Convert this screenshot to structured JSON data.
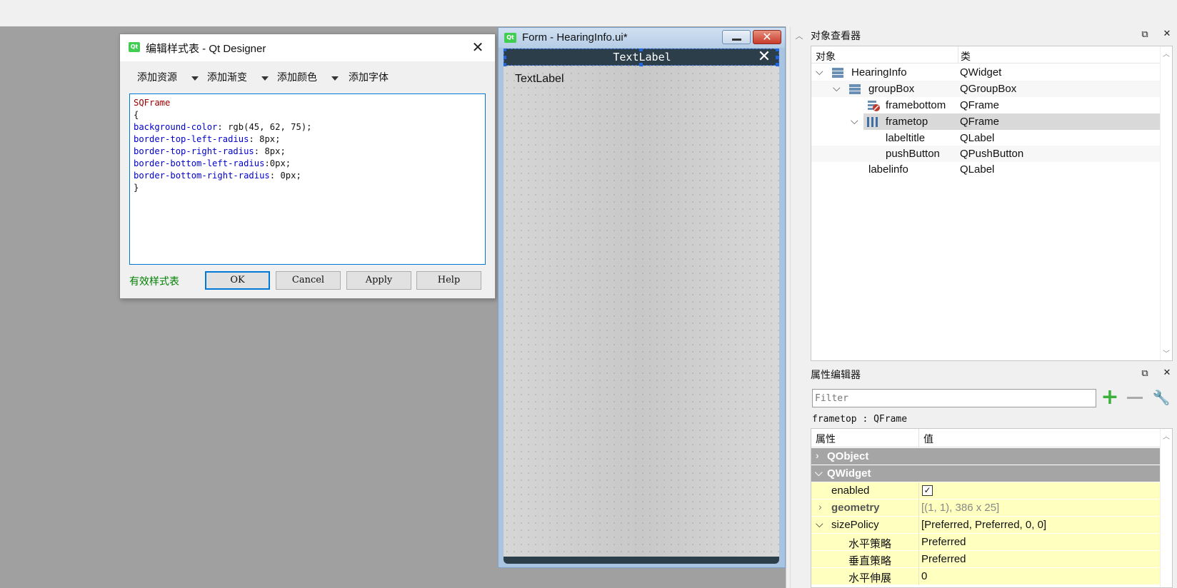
{
  "dialog": {
    "title": "编辑样式表 - Qt Designer",
    "close_glyph": "✕",
    "icon_text": "Qt",
    "toolbar": [
      "添加资源",
      "添加渐变",
      "添加颜色",
      "添加字体"
    ],
    "code": {
      "selector": "SQFrame",
      "open": "{",
      "props": [
        {
          "name": "background-color",
          "sep": ": ",
          "value": "rgb(45, 62, 75);"
        },
        {
          "name": "border-top-left-radius",
          "sep": ": ",
          "value": "8px;"
        },
        {
          "name": "border-top-right-radius",
          "sep": ": ",
          "value": "8px;"
        },
        {
          "name": "border-bottom-left-radius",
          "sep": ":",
          "value": "0px;"
        },
        {
          "name": "border-bottom-right-radius",
          "sep": ": ",
          "value": "0px;"
        }
      ],
      "close": "}"
    },
    "status": "有效样式表",
    "buttons": {
      "ok": "OK",
      "cancel": "Cancel",
      "apply": "Apply",
      "help": "Help"
    }
  },
  "form": {
    "title": "Form - HearingInfo.ui*",
    "icon_text": "Qt",
    "close_glyph": "✕",
    "frametop_label": "TextLabel",
    "frametop_close": "✕",
    "labelinfo_text": "TextLabel"
  },
  "object_inspector": {
    "title": "对象查看器",
    "columns": {
      "object": "对象",
      "class": "类"
    },
    "rows": [
      {
        "name": "HearingInfo",
        "class": "QWidget",
        "expanded": true,
        "icon": "widget-icon"
      },
      {
        "name": "groupBox",
        "class": "QGroupBox",
        "expanded": true,
        "icon": "groupbox-icon"
      },
      {
        "name": "framebottom",
        "class": "QFrame",
        "icon": "frame-error-icon"
      },
      {
        "name": "frametop",
        "class": "QFrame",
        "expanded": true,
        "selected": true,
        "icon": "frame-layout-icon"
      },
      {
        "name": "labeltitle",
        "class": "QLabel"
      },
      {
        "name": "pushButton",
        "class": "QPushButton"
      },
      {
        "name": "labelinfo",
        "class": "QLabel"
      }
    ]
  },
  "property_editor": {
    "title": "属性编辑器",
    "filter_placeholder": "Filter",
    "object_line": "frametop : QFrame",
    "columns": {
      "property": "属性",
      "value": "值"
    },
    "rows": [
      {
        "type": "group",
        "name": "QObject",
        "collapsed": true
      },
      {
        "type": "group",
        "name": "QWidget",
        "collapsed": false
      },
      {
        "type": "prop",
        "name": "enabled",
        "value": "✓"
      },
      {
        "type": "prop",
        "name": "geometry",
        "value": "[(1, 1), 386 x 25]",
        "expandable": true,
        "bold": true,
        "dim": true
      },
      {
        "type": "prop",
        "name": "sizePolicy",
        "value": "[Preferred, Preferred, 0, 0]",
        "expanded": true
      },
      {
        "type": "sub",
        "name": "水平策略",
        "value": "Preferred"
      },
      {
        "type": "sub",
        "name": "垂直策略",
        "value": "Preferred"
      },
      {
        "type": "sub",
        "name": "水平伸展",
        "value": "0"
      }
    ]
  },
  "colors": {
    "frametop_bg": "#2d3e4b",
    "accent": "#0078d7",
    "valid_text": "#008000",
    "property_group": "#a5a5a5",
    "property_row": "#ffffc0"
  }
}
